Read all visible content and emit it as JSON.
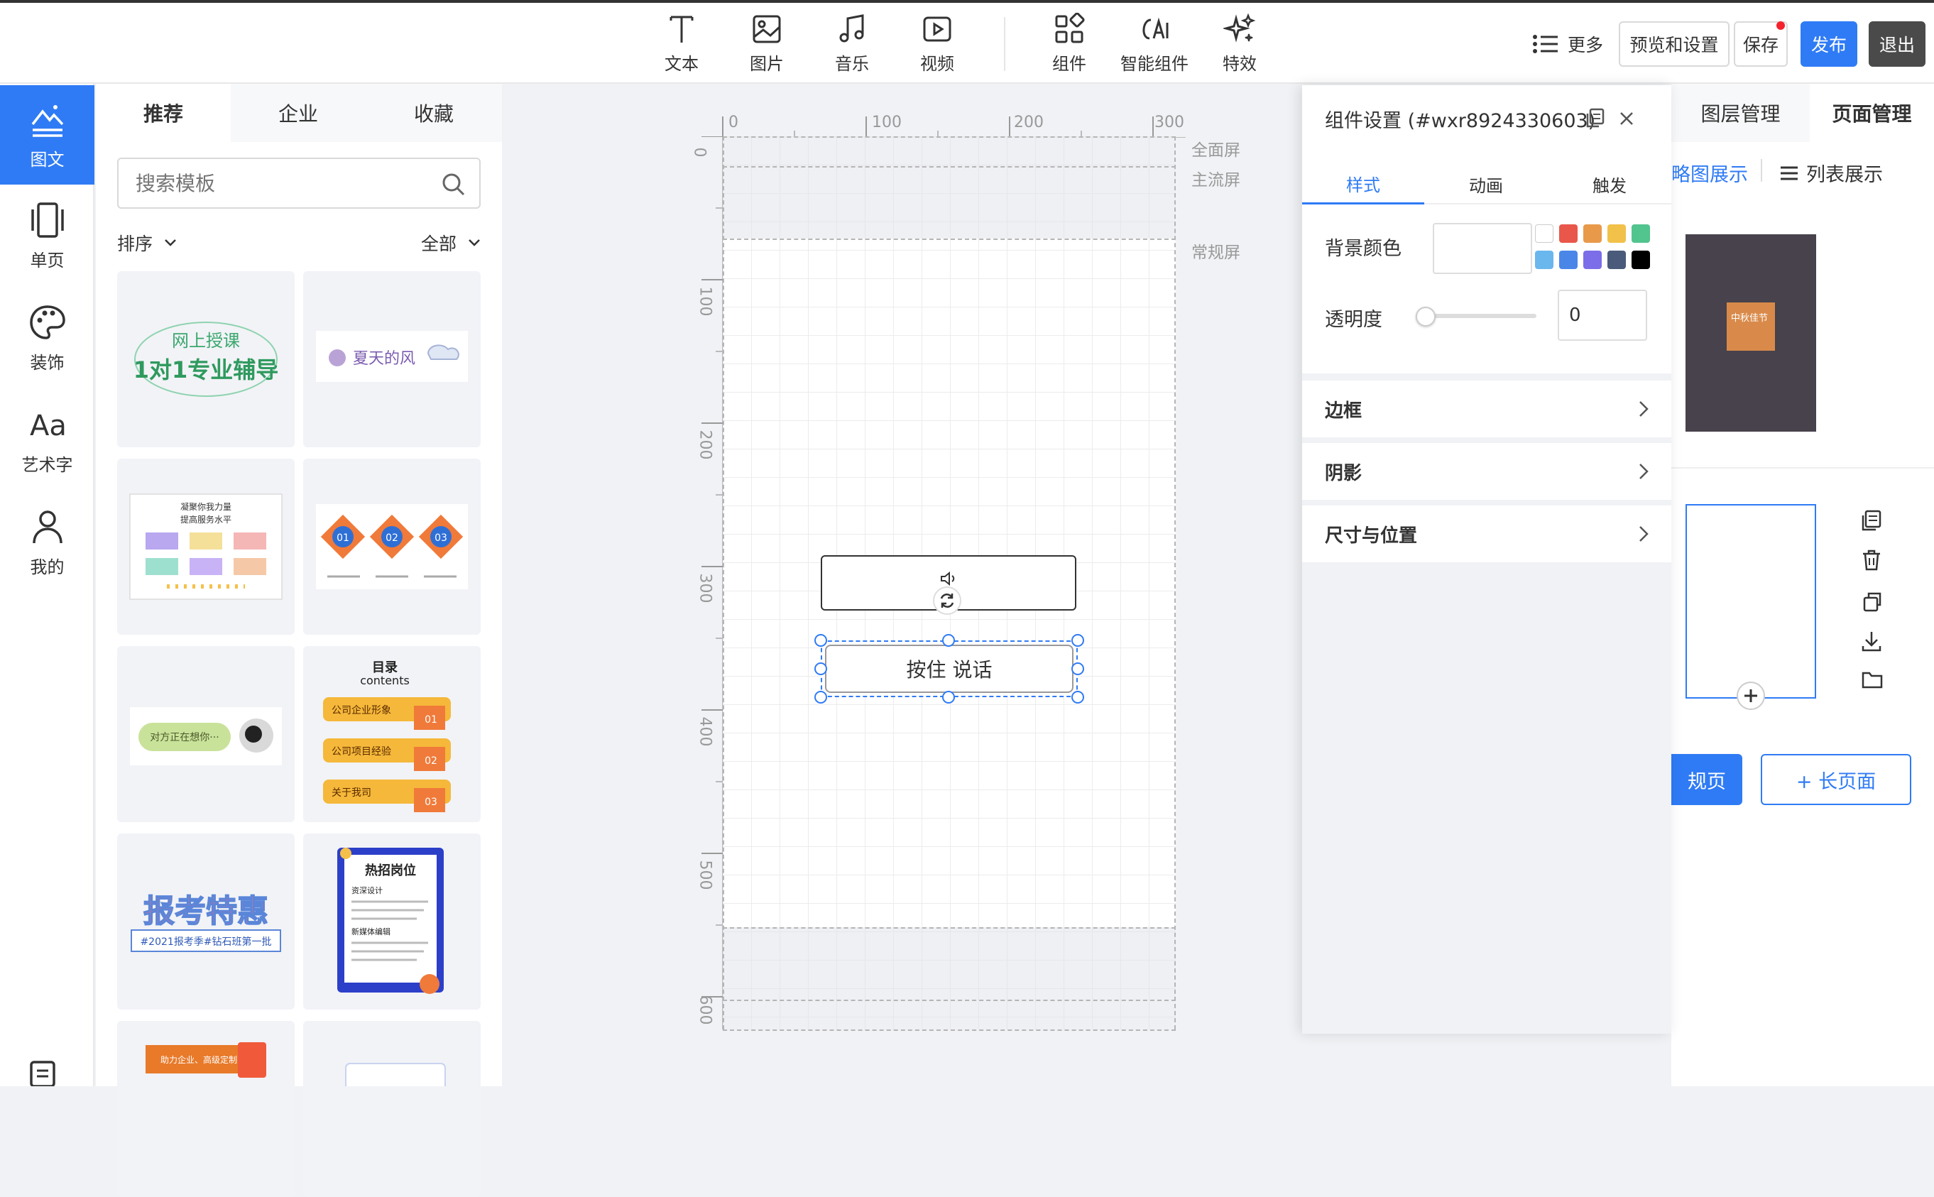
{
  "toolbar": {
    "tools": [
      {
        "label": "文本",
        "icon": "text-icon"
      },
      {
        "label": "图片",
        "icon": "image-icon"
      },
      {
        "label": "音乐",
        "icon": "music-icon"
      },
      {
        "label": "视频",
        "icon": "video-icon"
      },
      {
        "label": "组件",
        "icon": "component-icon"
      },
      {
        "label": "智能组件",
        "icon": "ai-icon"
      },
      {
        "label": "特效",
        "icon": "sparkle-icon"
      }
    ],
    "more_label": "更多",
    "preview_label": "预览和设置",
    "save_label": "保存",
    "publish_label": "发布",
    "exit_label": "退出"
  },
  "leftnav": {
    "items": [
      {
        "label": "图文",
        "icon": "mountain-text-icon",
        "active": true
      },
      {
        "label": "单页",
        "icon": "single-page-icon"
      },
      {
        "label": "装饰",
        "icon": "palette-icon"
      },
      {
        "label": "艺术字",
        "icon": "art-text-icon"
      },
      {
        "label": "我的",
        "icon": "user-icon"
      }
    ],
    "bottom_icon": "clipboard-icon"
  },
  "templates": {
    "tabs": [
      "推荐",
      "企业",
      "收藏"
    ],
    "search_placeholder": "搜索模板",
    "sort_label": "排序",
    "filter_label": "全部",
    "cards": {
      "c1_line1": "网上授课",
      "c1_line2": "1对1专业辅导",
      "c2": "夏天的风",
      "c3_title1": "凝聚你我力量",
      "c3_title2": "提高服务水平",
      "c4_nums": [
        "01",
        "02",
        "03"
      ],
      "c5": "对方正在想你···",
      "c6_title": "目录",
      "c6_sub": "contents",
      "c6_items": [
        "公司企业形象",
        "公司项目经验",
        "关于我司"
      ],
      "c6_nums": [
        "01",
        "02",
        "03"
      ],
      "c7_big": "报考特惠",
      "c7_small": "#2021报考季#钻石班第一批",
      "c8_title": "热招岗位",
      "c8_sub1": "资深设计",
      "c8_sub2": "新媒体编辑",
      "c9": "助力企业、高级定制"
    }
  },
  "canvas": {
    "ruler_top": [
      "0",
      "100",
      "200",
      "300"
    ],
    "ruler_left": [
      "0",
      "100",
      "200",
      "300",
      "400",
      "500",
      "600"
    ],
    "screen_labels": [
      "全面屏",
      "主流屏",
      "常规屏"
    ],
    "button_text": "按住 说话"
  },
  "settings": {
    "title": "组件设置 (#wxr8924330603)",
    "tabs": [
      "样式",
      "动画",
      "触发"
    ],
    "bg_color_label": "背景颜色",
    "opacity_label": "透明度",
    "opacity_value": "0",
    "opacity_level": 0,
    "palette": [
      "#ffffff",
      "#e8574a",
      "#e89a4a",
      "#f2c14a",
      "#52c48e",
      "#6ab7ee",
      "#4a86e8",
      "#7b6ee8",
      "#4a5a7a",
      "#000000"
    ],
    "sections": [
      "边框",
      "阴影",
      "尺寸与位置"
    ]
  },
  "layers": {
    "tabs": [
      "图层管理",
      "页面管理"
    ],
    "view_thumb": "略图展示",
    "view_list": "列表展示",
    "thumb_text": "中秋佳节",
    "add_page_label": "规页",
    "long_page_label": "+ 长页面"
  },
  "colors": {
    "primary": "#2f7bf5",
    "dark": "#4a4a4a"
  }
}
